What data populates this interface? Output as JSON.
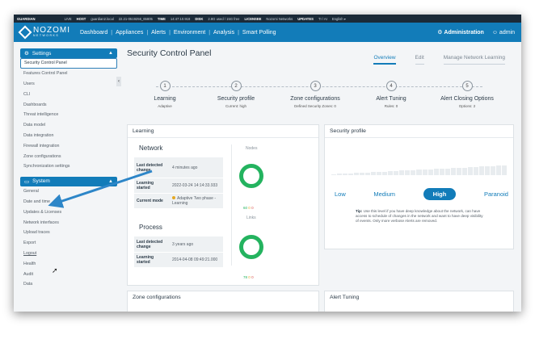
{
  "statusbar": {
    "brand": "GUARDIAN",
    "live": "LIVE",
    "host_label": "HOST",
    "host_value": "guardian2.local",
    "ip": "22.21-0519256_65805",
    "time_label": "TIME",
    "time_value": "14:47:10.918",
    "disk_label": "DISK",
    "disk_value": "2.8G used / 15G free",
    "licensee_label": "LICENSEE",
    "licensee_value": "Nozomi Networks",
    "updates_label": "UPDATES",
    "updates_value": "TI / AI",
    "language": "English ▾"
  },
  "navbar": {
    "logo_main": "NOZOMI",
    "logo_sub": "NETWORKS",
    "links": [
      "Dashboard",
      "Appliances",
      "Alerts",
      "Environment",
      "Analysis",
      "Smart Polling"
    ],
    "administration": "Administration",
    "admin": "admin"
  },
  "sidebar": {
    "settings_title": "Settings",
    "settings_items": [
      "Security Control Panel",
      "Features Control Panel",
      "Users",
      "CLI",
      "Dashboards",
      "Threat intelligence",
      "Data model",
      "Data integration",
      "Firewall integration",
      "Zone configurations",
      "Synchronization settings"
    ],
    "system_title": "System",
    "system_items": [
      "General",
      "Date and time",
      "Updates & Licenses",
      "Network interfaces",
      "Upload traces",
      "Export",
      "Logout",
      "Health",
      "Audit",
      "Data"
    ]
  },
  "main": {
    "title": "Security Control Panel",
    "tabs": [
      "Overview",
      "Edit",
      "Manage Network Learning"
    ],
    "steps": [
      {
        "num": "1",
        "title": "Learning",
        "sub": "Adaptive"
      },
      {
        "num": "2",
        "title": "Security profile",
        "sub": "Current: high"
      },
      {
        "num": "3",
        "title": "Zone configurations",
        "sub": "Defined Security Zones: 0"
      },
      {
        "num": "4",
        "title": "Alert Tuning",
        "sub": "Rules: 0"
      },
      {
        "num": "5",
        "title": "Alert Closing Options",
        "sub": "Options: 2"
      }
    ]
  },
  "learning_card": {
    "title": "Learning",
    "network_label": "Network",
    "network_rows": [
      {
        "k": "Last detected change",
        "v": "4 minutes ago"
      },
      {
        "k": "Learning started",
        "v": "2022-03-24 14:14:33.933"
      },
      {
        "k": "Current mode",
        "v": "Adaptive Two phase - Learning"
      }
    ],
    "nodes_label": "Nodes",
    "nodes_counts": [
      "60",
      "0",
      "0"
    ],
    "process_label": "Process",
    "process_rows": [
      {
        "k": "Last detected change",
        "v": "3 years ago"
      },
      {
        "k": "Learning started",
        "v": "2014-04-08 09:49:21.000"
      }
    ],
    "links_label": "Links",
    "links_counts": [
      "78",
      "0",
      "0"
    ]
  },
  "security_card": {
    "title": "Security profile",
    "levels": [
      "Low",
      "Medium",
      "High",
      "Paranoid"
    ],
    "selected": "High",
    "tip_label": "Tip:",
    "tip_text": "Use this level if you have deep knowledge about the network, can have access to schedule of changes in the network and want to have deep visibility of events. Only more verbose Alerts are removed."
  },
  "bottom_cards": {
    "zone": "Zone configurations",
    "alert": "Alert Tuning"
  },
  "colors": {
    "brand_blue": "#127cb9",
    "status_dark": "#1b2a38",
    "ok_green": "#24b35f",
    "arrow_blue": "#2d86c8"
  }
}
